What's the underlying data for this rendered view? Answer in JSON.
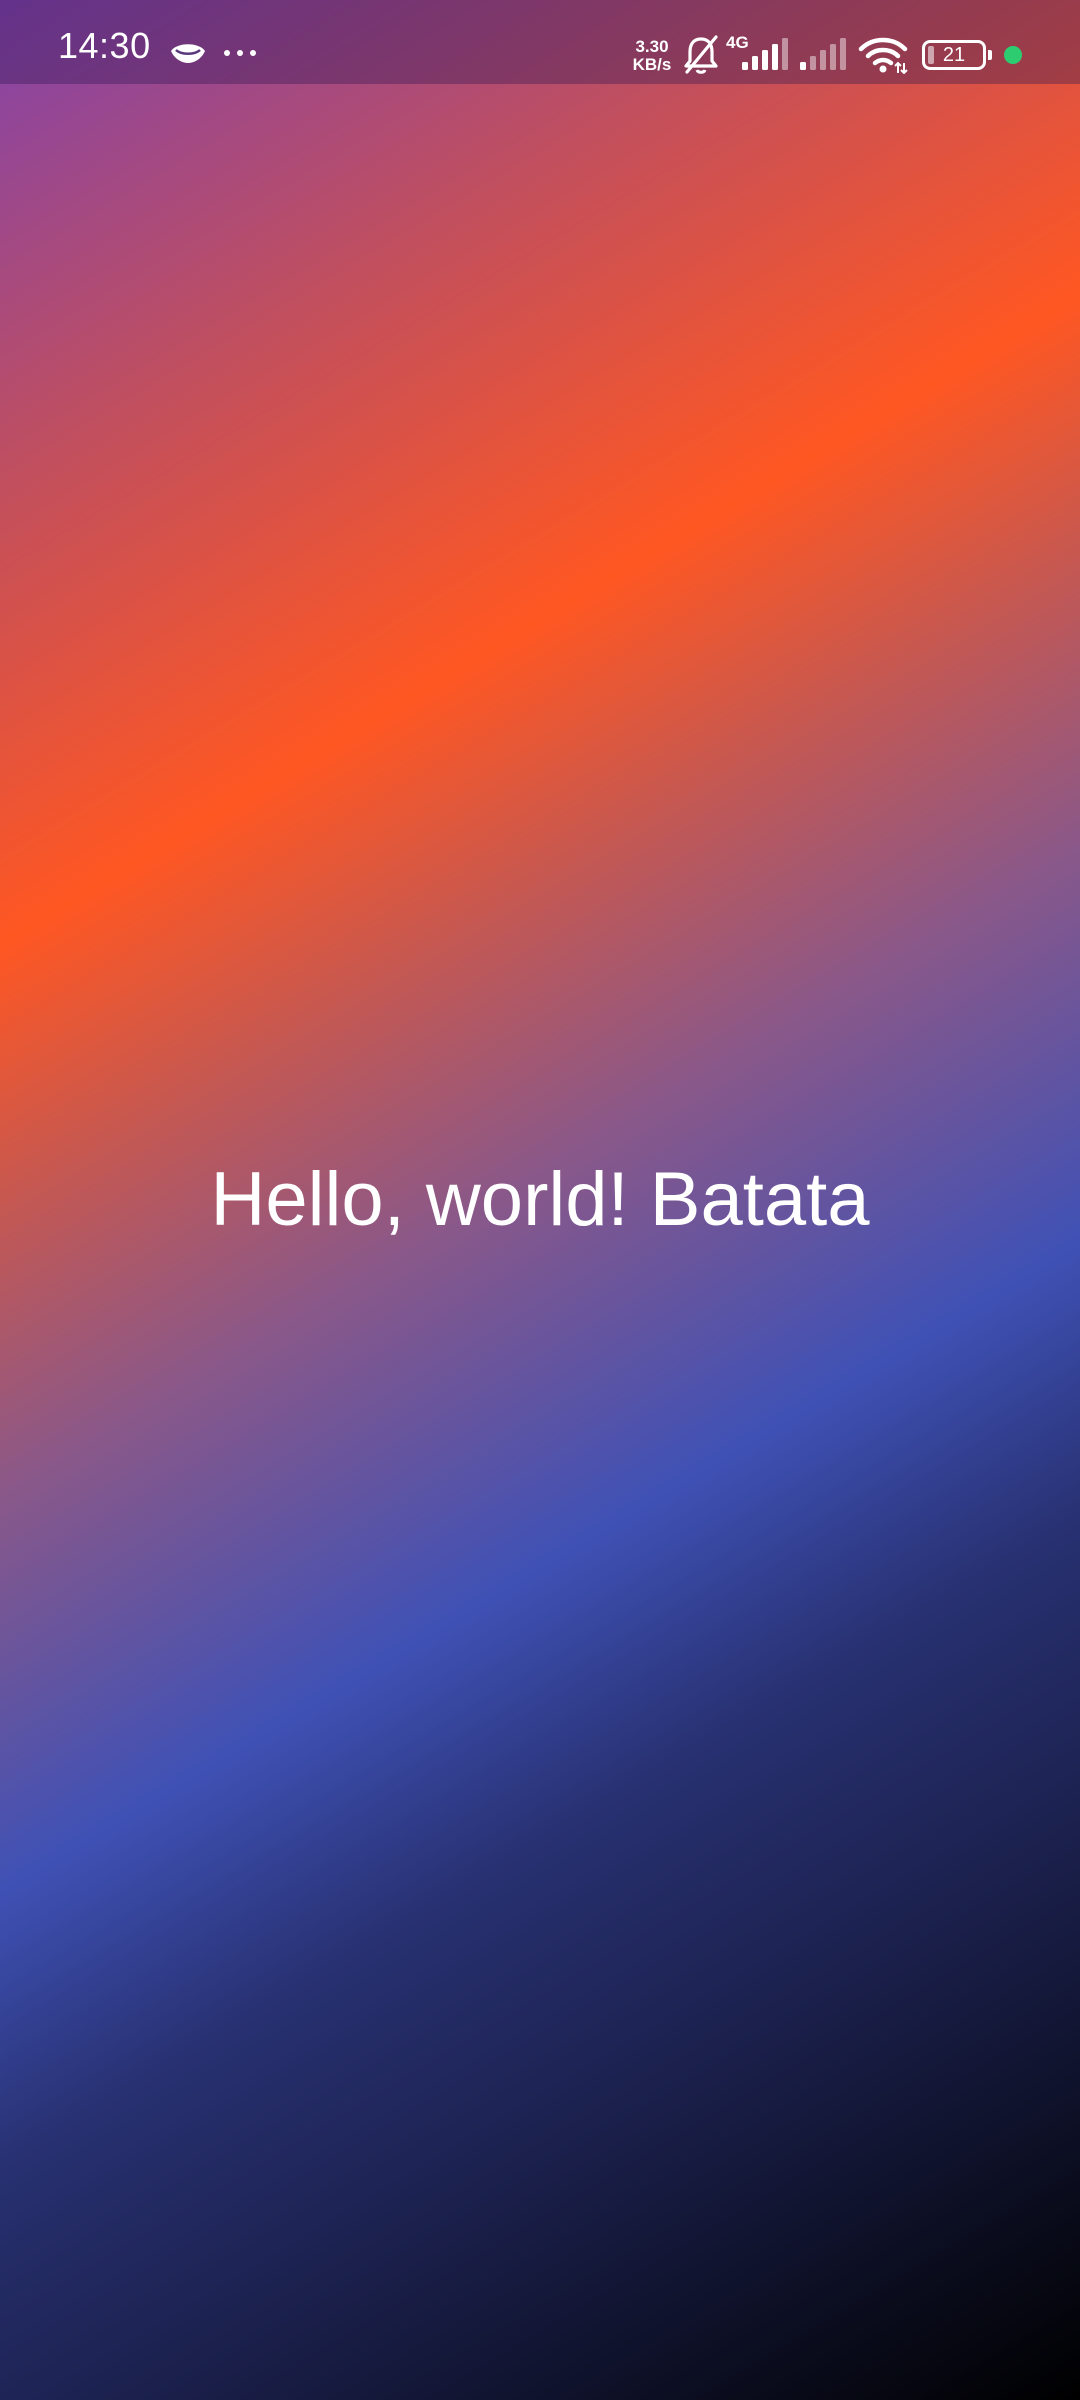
{
  "status_bar": {
    "time": "14:30",
    "notification_icons": [
      "eye-mask-icon",
      "more-dots-icon"
    ],
    "net_speed_value": "3.30",
    "net_speed_unit": "KB/s",
    "muted_bell_icon": "bell-off-icon",
    "network_type": "4G",
    "sim1_signal": 4,
    "sim2_signal": 1,
    "wifi_icon": "wifi-icon",
    "battery_level": "21",
    "privacy_dot_color": "#2ecc71"
  },
  "main": {
    "greeting": "Hello, world! Batata"
  },
  "colors": {
    "gradient": [
      "#8343ab",
      "#ff5722",
      "#3f51b5",
      "#000000"
    ]
  }
}
